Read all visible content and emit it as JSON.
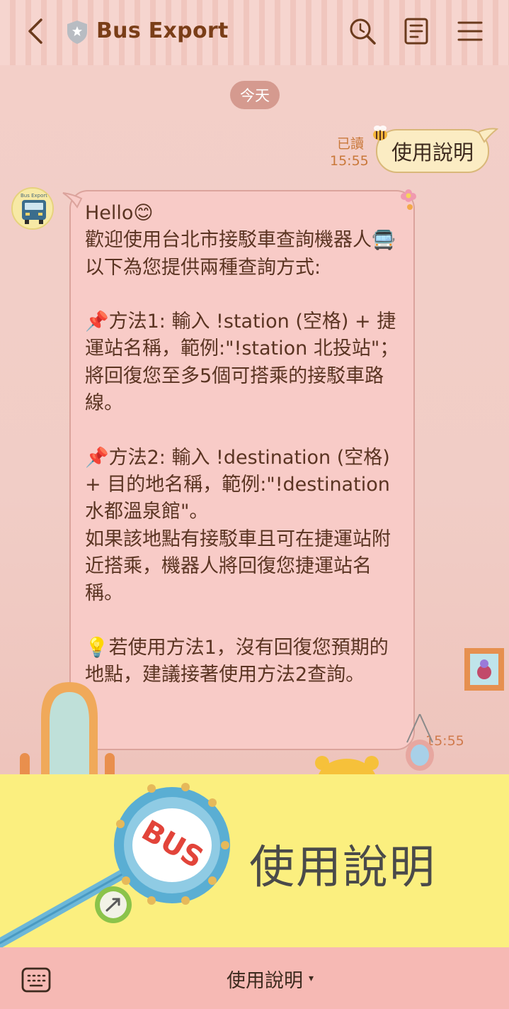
{
  "header": {
    "title": "Bus Export",
    "back_icon": "chevron-left-icon",
    "search_icon": "search-icon",
    "notes_icon": "notes-icon",
    "menu_icon": "hamburger-menu-icon"
  },
  "chat": {
    "date": "今天",
    "sent": {
      "read_label": "已讀",
      "time": "15:55",
      "text": "使用說明"
    },
    "received": {
      "avatar_label": "Bus Export",
      "time": "15:55",
      "text": "Hello😊\n歡迎使用台北市接駁車查詢機器人🚍\n以下為您提供兩種查詢方式:\n\n📌方法1: 輸入 !station (空格) + 捷運站名稱，範例:\"!station 北投站\"；將回復您至多5個可搭乘的接駁車路線。\n\n📌方法2: 輸入 !destination (空格) + 目的地名稱，範例:\"!destination 水都溫泉館\"。\n如果該地點有接駁車且可在捷運站附近搭乘，機器人將回復您捷運站名稱。\n\n💡若使用方法1，沒有回復您預期的地點，建議接著使用方法2查詢。"
    }
  },
  "richmenu": {
    "label": "使用說明",
    "sign_text": "BUS"
  },
  "bottombar": {
    "keyboard_icon": "keyboard-icon",
    "menu_label": "使用說明",
    "caret": "▾"
  },
  "colors": {
    "header_title": "#7a3e18",
    "bubble_received": "#f8cbc7",
    "bubble_sent": "#fbecc3",
    "richmenu_bg": "#fbef7f",
    "bottombar_bg": "#f6b9b4"
  }
}
